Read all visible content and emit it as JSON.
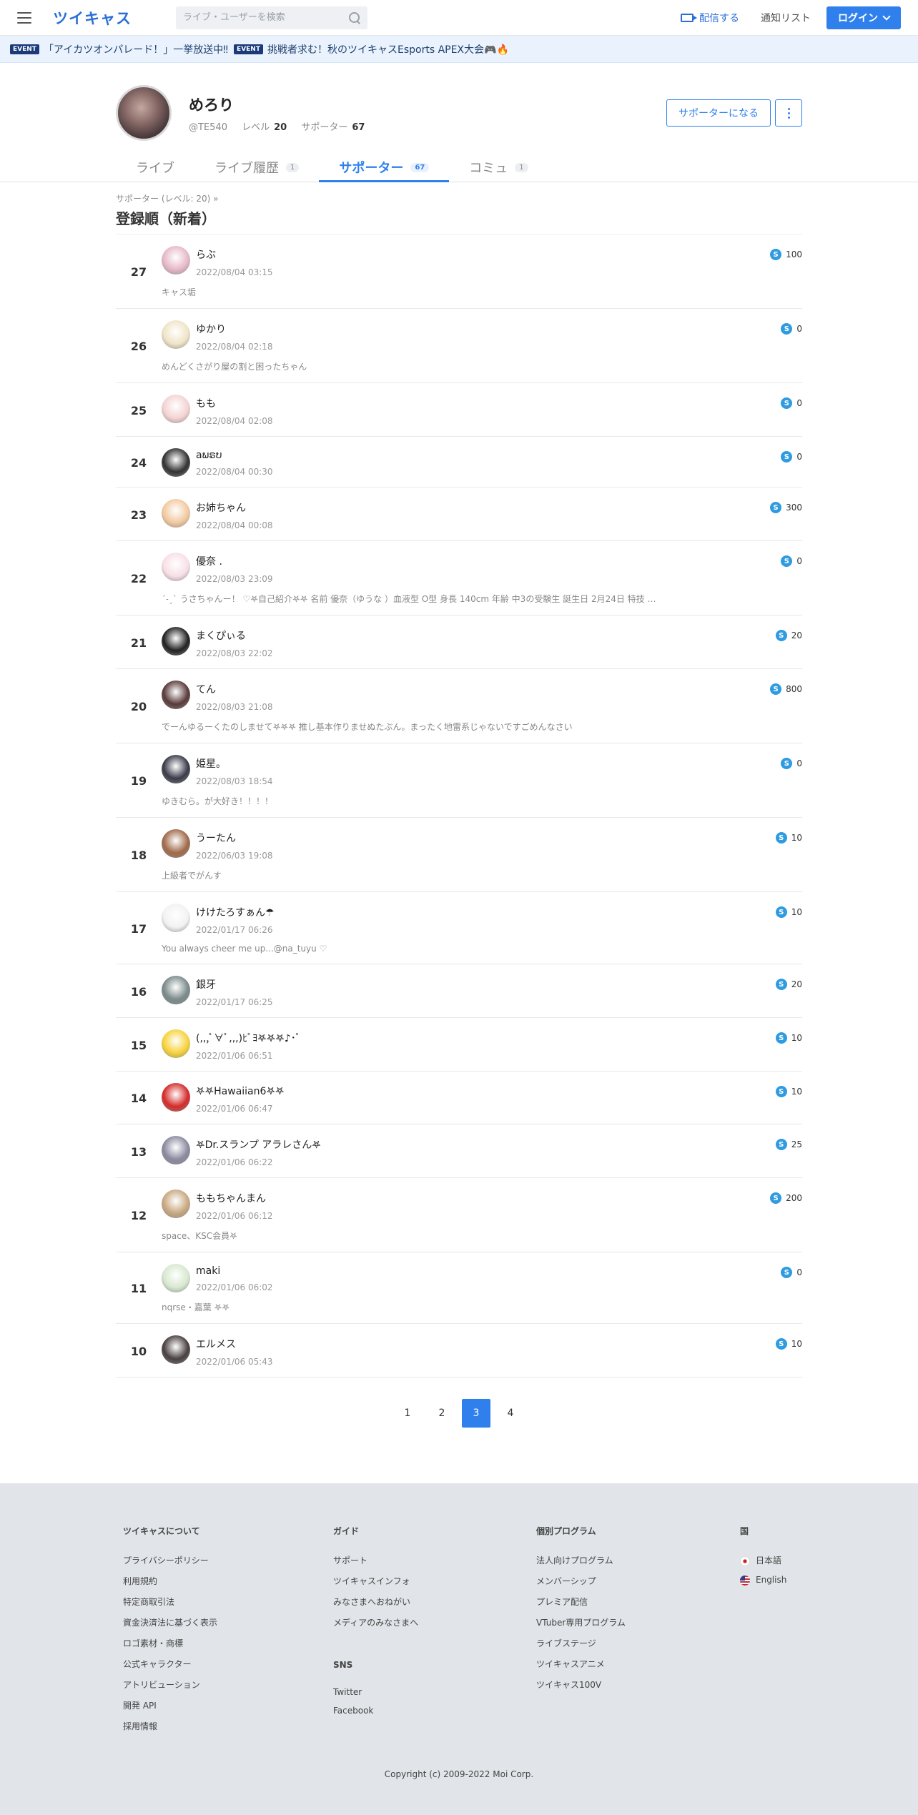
{
  "header": {
    "logo": "ツイキャス",
    "search_placeholder": "ライブ・ユーザーを検索",
    "broadcast_label": "配信する",
    "notify_label": "通知リスト",
    "login_label": "ログイン"
  },
  "events": [
    {
      "badge": "EVENT",
      "text": "「アイカツオンパレード！」一挙放送中‼"
    },
    {
      "badge": "EVENT",
      "text": "挑戦者求む！秋のツイキャスEsports APEX大会🎮🔥"
    }
  ],
  "profile": {
    "name": "めろり",
    "handle": "@TE540",
    "level_label": "レベル",
    "level": "20",
    "supporters_label": "サポーター",
    "supporters": "67",
    "become_supporter_label": "サポーターになる"
  },
  "tabs": [
    {
      "label": "ライブ",
      "count": ""
    },
    {
      "label": "ライブ履歴",
      "count": "1"
    },
    {
      "label": "サポーター",
      "count": "67"
    },
    {
      "label": "コミュ",
      "count": "1"
    }
  ],
  "list": {
    "breadcrumb": "サポーター (レベル: 20) »",
    "title": "登録順（新着）",
    "rows": [
      {
        "rank": "27",
        "name": "らぶ",
        "date": "2022/08/04 03:15",
        "comment": "キャス垢",
        "points": "100"
      },
      {
        "rank": "26",
        "name": "ゆかり",
        "date": "2022/08/04 02:18",
        "comment": "めんどくさがり屋の割と困ったちゃん",
        "points": "0"
      },
      {
        "rank": "25",
        "name": "もも",
        "date": "2022/08/04 02:08",
        "comment": "",
        "points": "0"
      },
      {
        "rank": "24",
        "name": "aພຣບ",
        "date": "2022/08/04 00:30",
        "comment": "",
        "points": "0"
      },
      {
        "rank": "23",
        "name": "お姉ちゃん",
        "date": "2022/08/04 00:08",
        "comment": "",
        "points": "300"
      },
      {
        "rank": "22",
        "name": "優奈 .",
        "date": "2022/08/03 23:09",
        "comment": "ˊ˗ˏˋ うさちゃんー！ ♡𖤐自己紹介𖤐𖤐 名前 優奈（ゆうな ）血液型 O型 身長 140cm 年齢 中3の受験生 誕生日 2月24日 特技 ダ...",
        "points": "0"
      },
      {
        "rank": "21",
        "name": "まくぴぃる",
        "date": "2022/08/03 22:02",
        "comment": "",
        "points": "20"
      },
      {
        "rank": "20",
        "name": "てん",
        "date": "2022/08/03 21:08",
        "comment": "でーんゆるーくたのしませて𖤐𖤐𖤐 推し基本作りませぬたぶん。まったく地雷系じゃないですごめんなさい",
        "points": "800"
      },
      {
        "rank": "19",
        "name": "姫星。",
        "date": "2022/08/03 18:54",
        "comment": "ゆきむら。が大好き！！！！",
        "points": "0"
      },
      {
        "rank": "18",
        "name": "うーたん",
        "date": "2022/06/03 19:08",
        "comment": "上級者でがんす",
        "points": "10"
      },
      {
        "rank": "17",
        "name": "けけたろすぁん☂",
        "date": "2022/01/17 06:26",
        "comment": "You always cheer me up...@na_tuyu ♡",
        "points": "10"
      },
      {
        "rank": "16",
        "name": "銀牙",
        "date": "2022/01/17 06:25",
        "comment": "",
        "points": "20"
      },
      {
        "rank": "15",
        "name": "(,,,ﾟ∀ﾟ,,,)ﾋﾟﾖ𖤐𖤐𖤐♪･ﾟ",
        "date": "2022/01/06 06:51",
        "comment": "",
        "points": "10"
      },
      {
        "rank": "14",
        "name": "𖤐𖤐Hawaiian6𖤐𖤐",
        "date": "2022/01/06 06:47",
        "comment": "",
        "points": "10"
      },
      {
        "rank": "13",
        "name": "𖤐Dr.スランプ アラレさん𖤐",
        "date": "2022/01/06 06:22",
        "comment": "",
        "points": "25"
      },
      {
        "rank": "12",
        "name": "ももちゃんまん",
        "date": "2022/01/06 06:12",
        "comment": "space、KSC会員𖤐",
        "points": "200"
      },
      {
        "rank": "11",
        "name": "maki",
        "date": "2022/01/06 06:02",
        "comment": "nqrse・嘉葉 𖤐𖤐",
        "points": "0"
      },
      {
        "rank": "10",
        "name": "エルメス",
        "date": "2022/01/06 05:43",
        "comment": "",
        "points": "10"
      }
    ]
  },
  "pagination": {
    "pages": [
      "1",
      "2",
      "3",
      "4"
    ],
    "current": "3"
  },
  "footer": {
    "col1": {
      "title": "ツイキャスについて",
      "items": [
        "プライバシーポリシー",
        "利用規約",
        "特定商取引法",
        "資金決済法に基づく表示",
        "ロゴ素材・商標",
        "公式キャラクター",
        "アトリビューション",
        "開発 API",
        "採用情報"
      ]
    },
    "col2": {
      "title": "ガイド",
      "items": [
        "サポート",
        "ツイキャスインフォ",
        "みなさまへおねがい",
        "メディアのみなさまへ"
      ]
    },
    "col2b": {
      "title": "SNS",
      "items": [
        "Twitter",
        "Facebook"
      ]
    },
    "col3": {
      "title": "個別プログラム",
      "items": [
        "法人向けプログラム",
        "メンバーシップ",
        "プレミア配信",
        "VTuber専用プログラム",
        "ライブステージ",
        "ツイキャスアニメ",
        "ツイキャス100V"
      ]
    },
    "col4": {
      "title": "国",
      "items": [
        "日本語",
        "English"
      ]
    },
    "copyright": "Copyright (c) 2009-2022 Moi Corp."
  },
  "avatar_colors": [
    "#e6b8c8",
    "#f0e4c8",
    "#f4d3d3",
    "#333333",
    "#f2c9a0",
    "#f7dfe6",
    "#222222",
    "#5a3a3a",
    "#3a3a4a",
    "#a06a4a",
    "#f2f2f2",
    "#7a8a8a",
    "#f7d23a",
    "#d62a2a",
    "#8a8aa0",
    "#c8a880",
    "#d8e8d0",
    "#4a4040"
  ]
}
